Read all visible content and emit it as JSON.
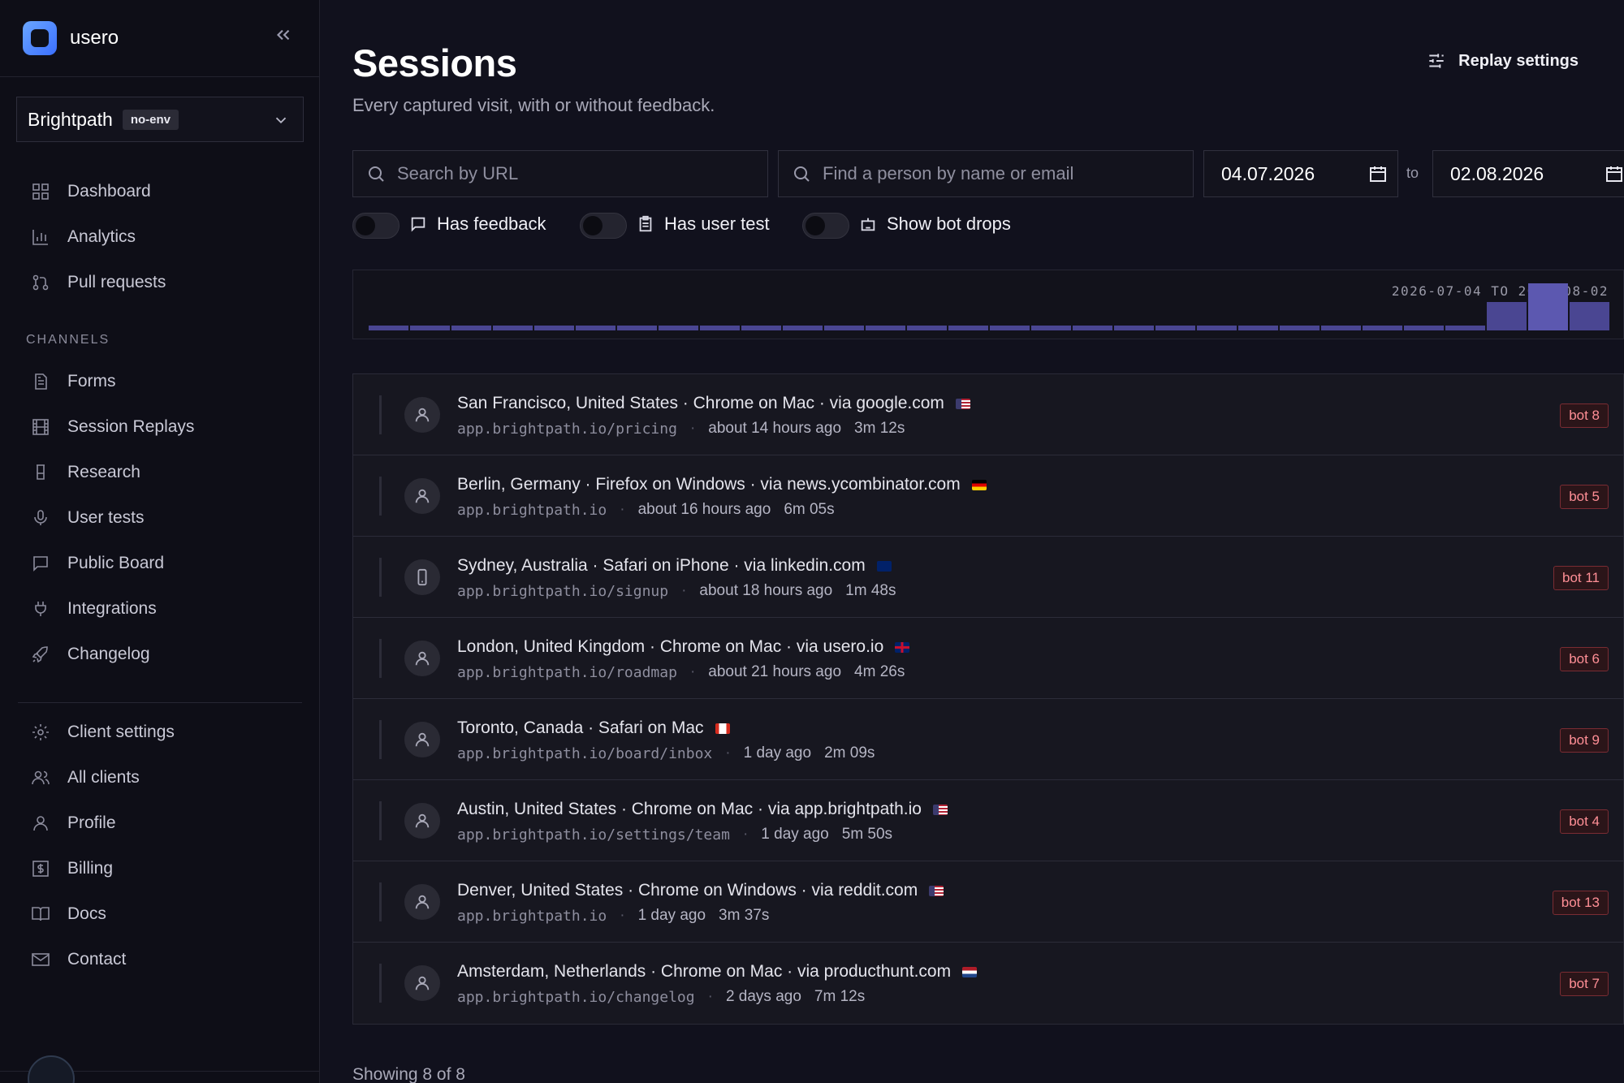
{
  "app": {
    "name": "usero"
  },
  "workspace": {
    "name": "Brightpath",
    "env_badge": "no-env"
  },
  "nav": {
    "main": [
      {
        "label": "Dashboard",
        "icon": "grid-icon"
      },
      {
        "label": "Analytics",
        "icon": "bar-chart-icon"
      },
      {
        "label": "Pull requests",
        "icon": "git-pull-request-icon"
      }
    ],
    "channels_label": "CHANNELS",
    "channels": [
      {
        "label": "Forms",
        "icon": "document-icon"
      },
      {
        "label": "Session Replays",
        "icon": "film-icon"
      },
      {
        "label": "Research",
        "icon": "flask-icon"
      },
      {
        "label": "User tests",
        "icon": "microphone-icon"
      },
      {
        "label": "Public Board",
        "icon": "message-square-icon"
      },
      {
        "label": "Integrations",
        "icon": "plug-icon"
      },
      {
        "label": "Changelog",
        "icon": "rocket-icon"
      }
    ],
    "account": [
      {
        "label": "Client settings",
        "icon": "gear-icon"
      },
      {
        "label": "All clients",
        "icon": "users-icon"
      },
      {
        "label": "Profile",
        "icon": "user-icon"
      },
      {
        "label": "Billing",
        "icon": "dollar-icon"
      },
      {
        "label": "Docs",
        "icon": "book-icon"
      },
      {
        "label": "Contact",
        "icon": "mail-icon"
      }
    ]
  },
  "page": {
    "title": "Sessions",
    "subtitle": "Every captured visit, with or without feedback.",
    "replay_settings_label": "Replay settings"
  },
  "filters": {
    "url_placeholder": "Search by URL",
    "person_placeholder": "Find a person by name or email",
    "date_from": "04.07.2026",
    "date_to": "02.08.2026",
    "to_label": "to",
    "toggles": [
      {
        "label": "Has feedback",
        "icon": "message-icon",
        "on": false
      },
      {
        "label": "Has user test",
        "icon": "clipboard-icon",
        "on": false
      },
      {
        "label": "Show bot drops",
        "icon": "bot-icon",
        "on": false
      }
    ]
  },
  "histogram": {
    "range_label": "2026-07-04 TO 2026-08-02",
    "colors": {
      "base": "#4a4692",
      "hot": "#5c58b0"
    },
    "values": [
      0.5,
      0.5,
      0.5,
      0.5,
      0.5,
      0.5,
      0.5,
      0.5,
      0.5,
      0.5,
      0.5,
      0.5,
      0.5,
      0.5,
      0.5,
      0.5,
      0.5,
      0.5,
      0.5,
      0.5,
      0.5,
      0.5,
      0.5,
      0.5,
      0.5,
      0.5,
      0.5,
      3,
      5,
      3
    ]
  },
  "sessions": [
    {
      "title": "San Francisco, United States · Chrome on Mac · via google.com",
      "flag": "us",
      "url": "app.brightpath.io/pricing",
      "time": "about 14 hours ago",
      "duration": "3m 12s",
      "bot": "bot 8",
      "device": "user-icon"
    },
    {
      "title": "Berlin, Germany · Firefox on Windows · via news.ycombinator.com",
      "flag": "de",
      "url": "app.brightpath.io",
      "time": "about 16 hours ago",
      "duration": "6m 05s",
      "bot": "bot 5",
      "device": "user-icon"
    },
    {
      "title": "Sydney, Australia · Safari on iPhone · via linkedin.com",
      "flag": "au",
      "url": "app.brightpath.io/signup",
      "time": "about 18 hours ago",
      "duration": "1m 48s",
      "bot": "bot 11",
      "device": "phone-icon"
    },
    {
      "title": "London, United Kingdom · Chrome on Mac · via usero.io",
      "flag": "gb",
      "url": "app.brightpath.io/roadmap",
      "time": "about 21 hours ago",
      "duration": "4m 26s",
      "bot": "bot 6",
      "device": "user-icon"
    },
    {
      "title": "Toronto, Canada · Safari on Mac",
      "flag": "ca",
      "url": "app.brightpath.io/board/inbox",
      "time": "1 day ago",
      "duration": "2m 09s",
      "bot": "bot 9",
      "device": "user-icon"
    },
    {
      "title": "Austin, United States · Chrome on Mac · via app.brightpath.io",
      "flag": "us",
      "url": "app.brightpath.io/settings/team",
      "time": "1 day ago",
      "duration": "5m 50s",
      "bot": "bot 4",
      "device": "user-icon"
    },
    {
      "title": "Denver, United States · Chrome on Windows · via reddit.com",
      "flag": "us",
      "url": "app.brightpath.io",
      "time": "1 day ago",
      "duration": "3m 37s",
      "bot": "bot 13",
      "device": "user-icon"
    },
    {
      "title": "Amsterdam, Netherlands · Chrome on Mac · via producthunt.com",
      "flag": "nl",
      "url": "app.brightpath.io/changelog",
      "time": "2 days ago",
      "duration": "7m 12s",
      "bot": "bot 7",
      "device": "user-icon"
    }
  ],
  "footer": {
    "count_label": "Showing 8 of 8"
  }
}
